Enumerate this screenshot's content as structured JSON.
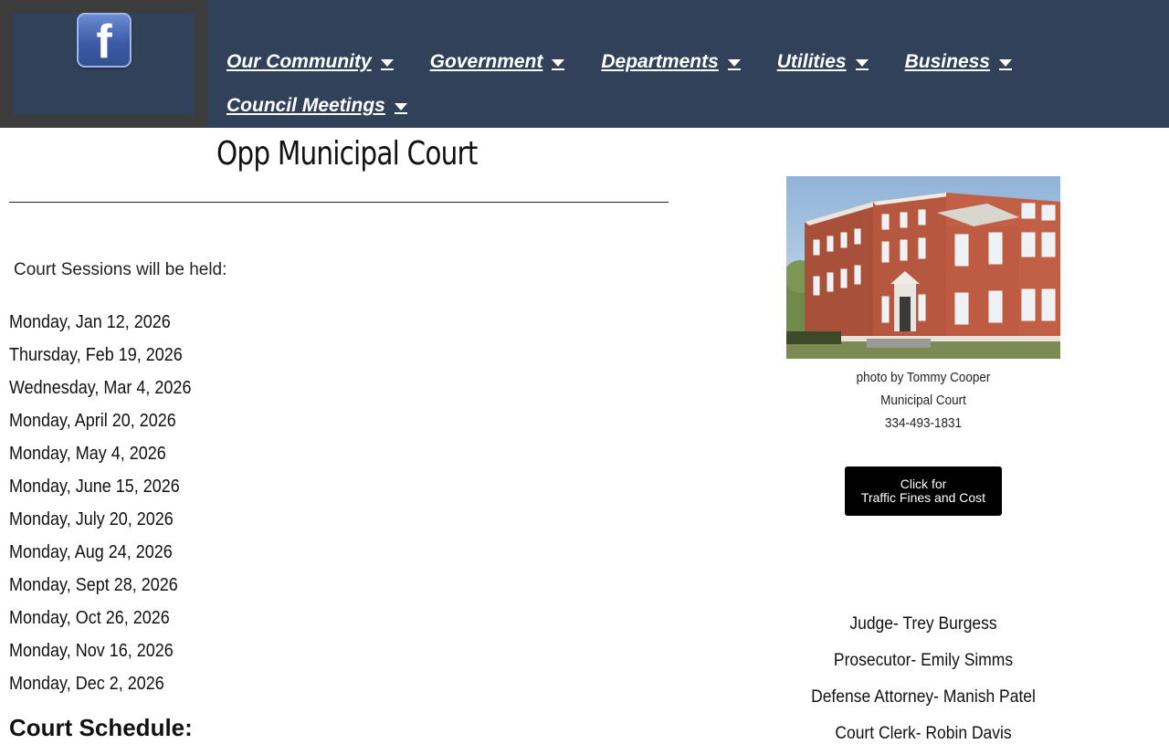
{
  "header": {
    "nav_row1": [
      {
        "label": "Our Community"
      },
      {
        "label": "Government"
      },
      {
        "label": "Departments"
      },
      {
        "label": "Utilities"
      },
      {
        "label": "Business"
      }
    ],
    "nav_row2": [
      {
        "label": "Council Meetings"
      }
    ],
    "logo_letter": "f",
    "logo_icon": "facebook-icon"
  },
  "main": {
    "title": "Opp Municipal Court",
    "intro": "Court Sessions will be held:",
    "dates": [
      "Monday, Jan 12, 2026",
      "Thursday, Feb 19, 2026",
      "Wednesday, Mar 4, 2026",
      "Monday, April 20, 2026",
      "Monday, May 4, 2026",
      "Monday, June 15, 2026",
      "Monday, July 20, 2026",
      "Monday, Aug 24, 2026",
      "Monday, Sept 28, 2026",
      "Monday, Oct 26, 2026",
      "Monday, Nov 16, 2026",
      "Monday, Dec 2, 2026"
    ],
    "schedule_heading": "Court Schedule:"
  },
  "sidebar": {
    "photo_credit": "photo by Tommy Cooper",
    "court_name": "Municipal Court",
    "phone": "334-493-1831",
    "button_line1": "Click for",
    "button_line2": "Traffic Fines and Cost",
    "judge": "Judge- Trey Burgess",
    "prosecutor": "Prosecutor- Emily Simms",
    "defense": "Defense Attorney- Manish Patel",
    "clerk": "Court Clerk- Robin Davis"
  },
  "colors": {
    "header_bg": "#31415a",
    "logo_frame": "#3d3d3d",
    "button_bg": "#000000"
  }
}
